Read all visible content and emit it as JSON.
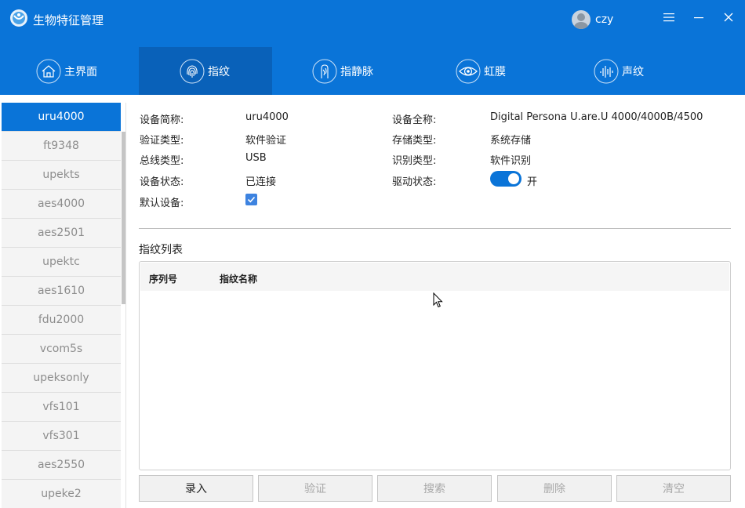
{
  "app": {
    "title": "生物特征管理",
    "user": "czy"
  },
  "window_controls": [
    "menu-icon",
    "minimize-icon",
    "close-icon"
  ],
  "tabs": [
    {
      "label": "主界面",
      "icon": "home-icon",
      "active": false
    },
    {
      "label": "指纹",
      "icon": "fingerprint-icon",
      "active": true
    },
    {
      "label": "指静脉",
      "icon": "finger-vein-icon",
      "active": false
    },
    {
      "label": "虹膜",
      "icon": "iris-icon",
      "active": false
    },
    {
      "label": "声纹",
      "icon": "voiceprint-icon",
      "active": false
    }
  ],
  "devices": [
    "uru4000",
    "ft9348",
    "upekts",
    "aes4000",
    "aes2501",
    "upektc",
    "aes1610",
    "fdu2000",
    "vcom5s",
    "upeksonly",
    "vfs101",
    "vfs301",
    "aes2550",
    "upeke2"
  ],
  "selected_device": "uru4000",
  "info": {
    "short_name_label": "设备简称:",
    "short_name": "uru4000",
    "full_name_label": "设备全称:",
    "full_name": "Digital Persona U.are.U 4000/4000B/4500",
    "verify_type_label": "验证类型:",
    "verify_type": "软件验证",
    "storage_type_label": "存储类型:",
    "storage_type": "系统存储",
    "bus_type_label": "总线类型:",
    "bus_type": "USB",
    "identify_type_label": "识别类型:",
    "identify_type": "软件识别",
    "device_status_label": "设备状态:",
    "device_status": "已连接",
    "driver_status_label": "驱动状态:",
    "driver_status": "开",
    "default_device_label": "默认设备:",
    "default_device_checked": true
  },
  "list": {
    "title": "指纹列表",
    "columns": [
      "序列号",
      "指纹名称"
    ],
    "rows": []
  },
  "buttons": [
    {
      "label": "录入",
      "enabled": true
    },
    {
      "label": "验证",
      "enabled": false
    },
    {
      "label": "搜索",
      "enabled": false
    },
    {
      "label": "删除",
      "enabled": false
    },
    {
      "label": "清空",
      "enabled": false
    }
  ],
  "colors": {
    "header": "#0a74d8",
    "active_tab": "#0961b9",
    "selected_item": "#0a74d8"
  }
}
